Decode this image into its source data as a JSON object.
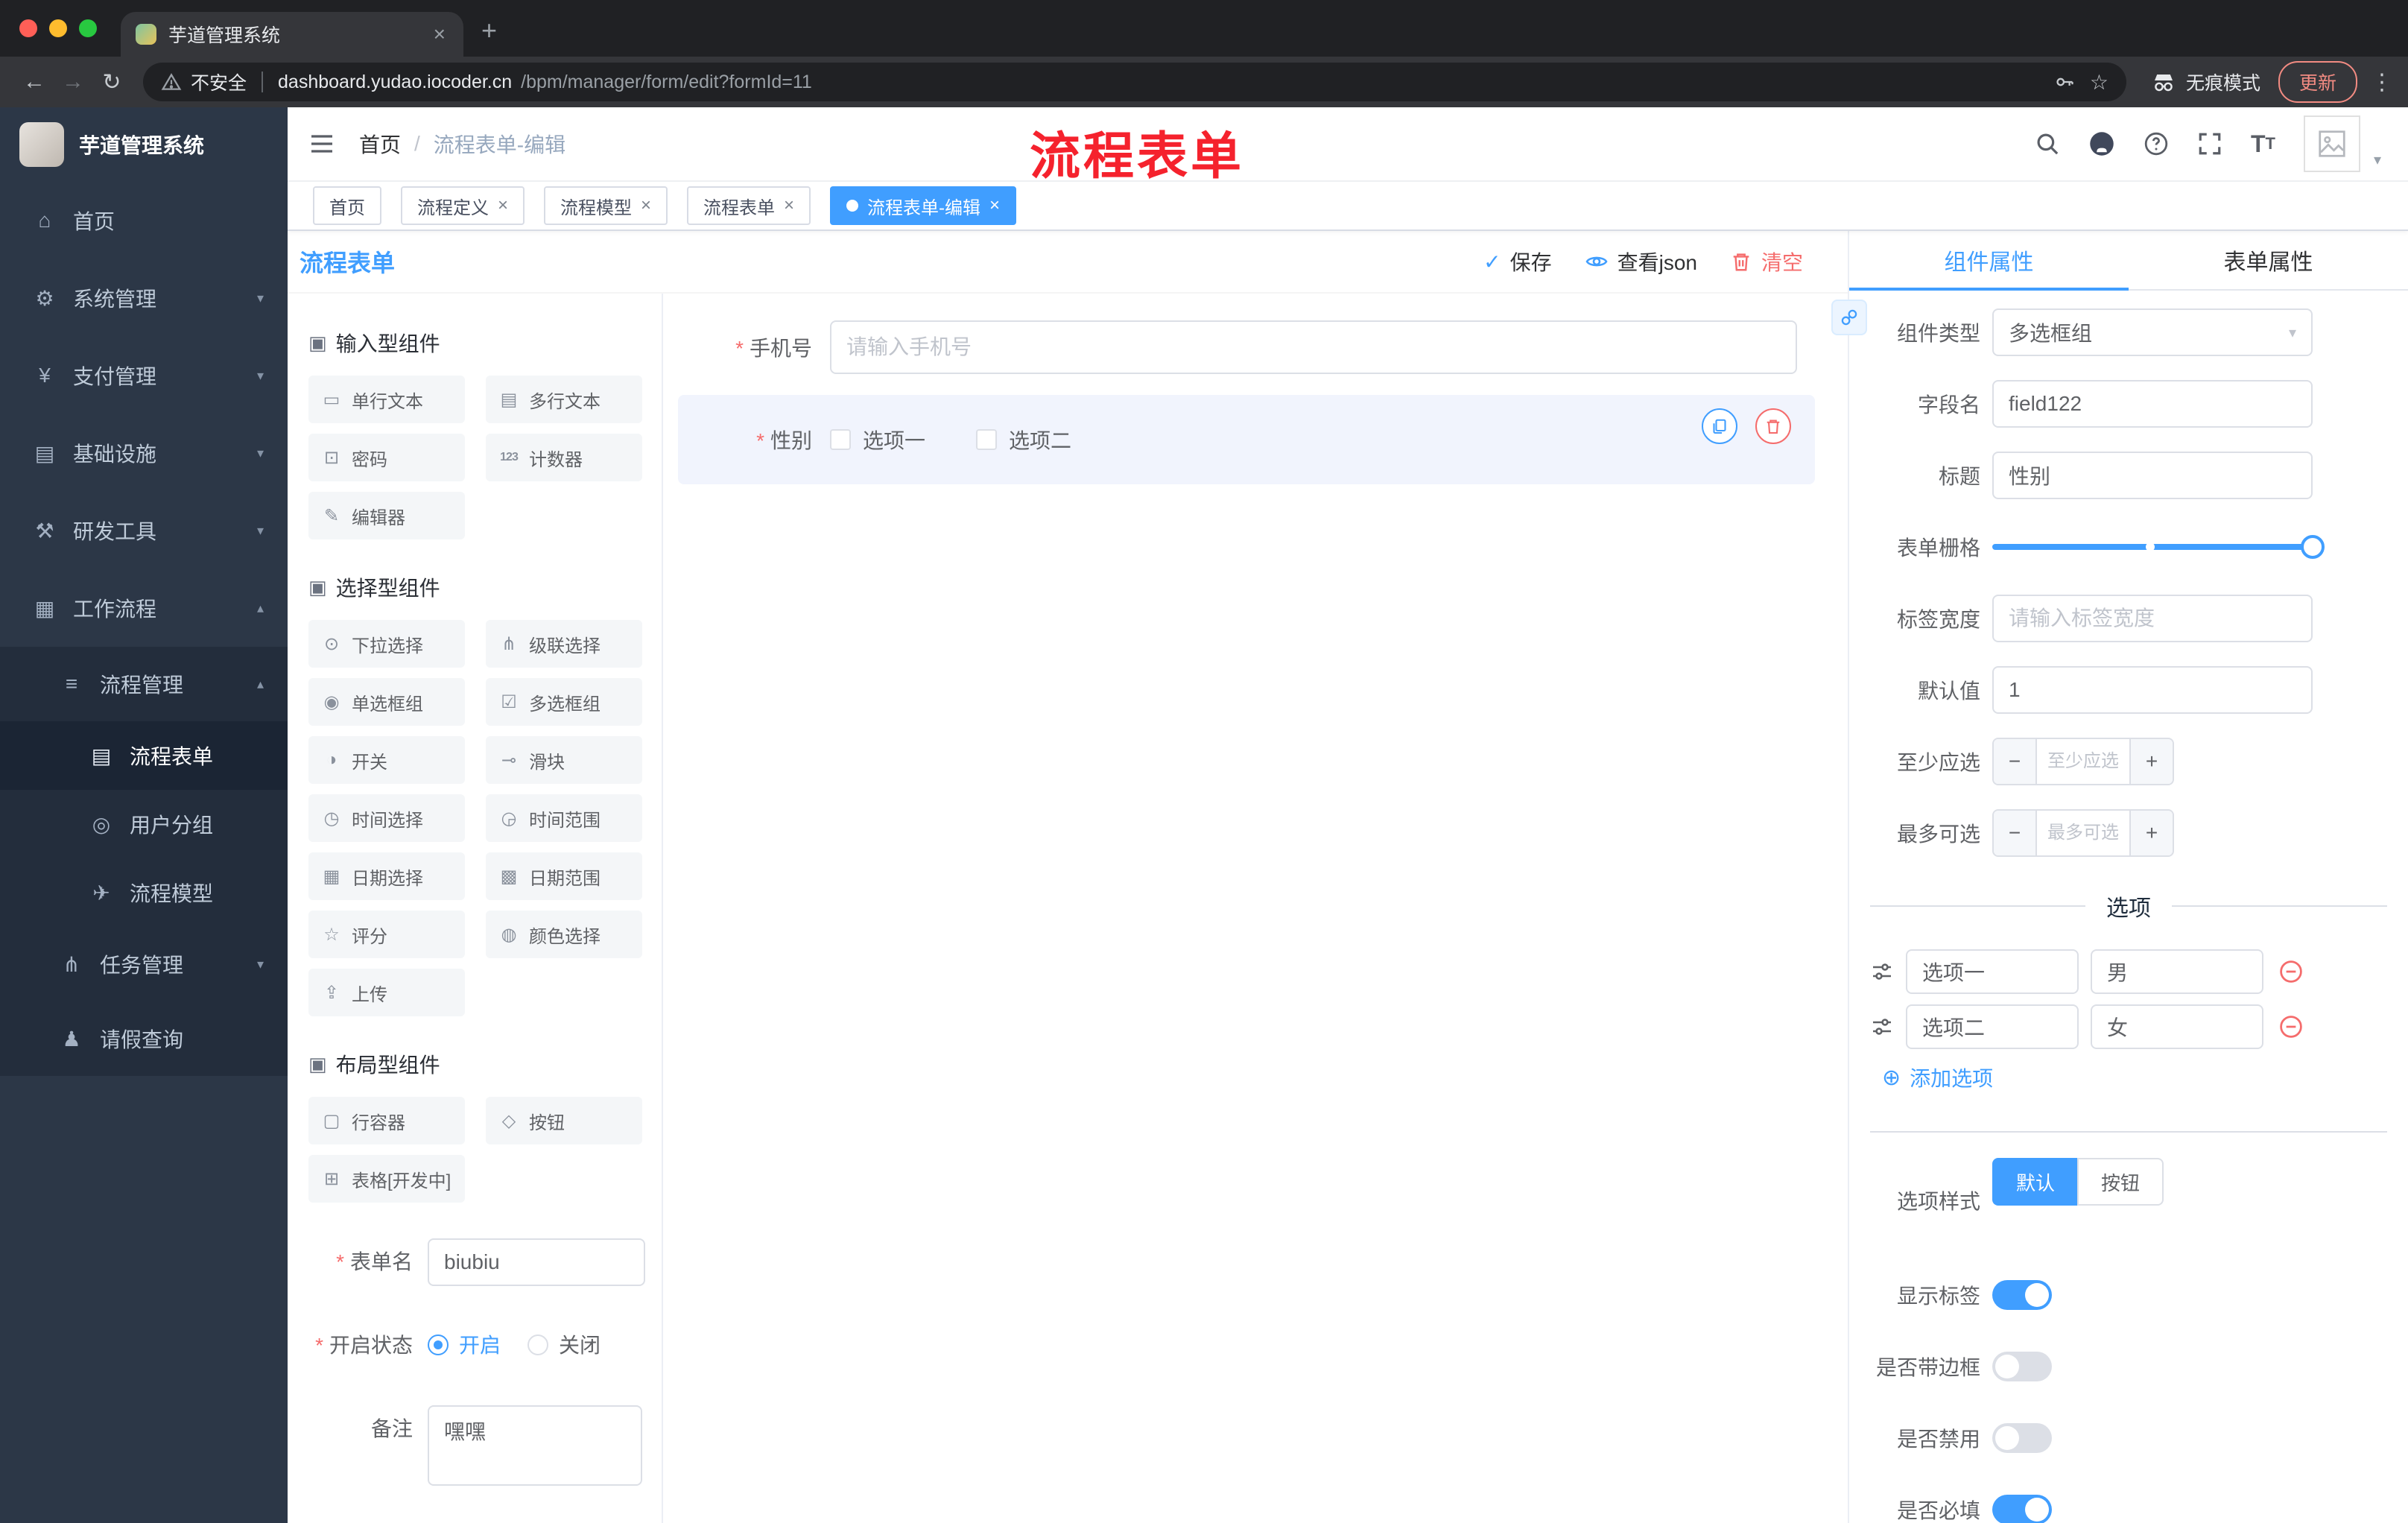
{
  "browser": {
    "tab_title": "芋道管理系统",
    "security": "不安全",
    "url_domain": "dashboard.yudao.iocoder.cn",
    "url_path": "/bpm/manager/form/edit?formId=11",
    "incognito": "无痕模式",
    "update": "更新"
  },
  "sidebar": {
    "title": "芋道管理系统",
    "items": [
      {
        "label": "首页",
        "icon": "⌂"
      },
      {
        "label": "系统管理",
        "icon": "⚙"
      },
      {
        "label": "支付管理",
        "icon": "¥"
      },
      {
        "label": "基础设施",
        "icon": "▤"
      },
      {
        "label": "研发工具",
        "icon": "⚒"
      },
      {
        "label": "工作流程",
        "icon": "▦"
      }
    ],
    "submenu": {
      "manage": {
        "label": "流程管理",
        "icon": "≡"
      },
      "children": [
        {
          "label": "流程表单",
          "icon": "▤"
        },
        {
          "label": "用户分组",
          "icon": "◎"
        },
        {
          "label": "流程模型",
          "icon": "✈"
        }
      ],
      "tasks": {
        "label": "任务管理",
        "icon": "⋔"
      },
      "leave": {
        "label": "请假查询",
        "icon": "♟"
      }
    }
  },
  "header": {
    "breadcrumb_home": "首页",
    "breadcrumb_sep": "/",
    "breadcrumb_current": "流程表单-编辑",
    "annotation": "流程表单"
  },
  "tags": [
    {
      "label": "首页"
    },
    {
      "label": "流程定义"
    },
    {
      "label": "流程模型"
    },
    {
      "label": "流程表单"
    },
    {
      "label": "流程表单-编辑"
    }
  ],
  "designer": {
    "title": "流程表单",
    "actions": {
      "save": "保存",
      "view_json": "查看json",
      "clear": "清空"
    },
    "groups": [
      {
        "title": "输入型组件",
        "items": [
          {
            "label": "单行文本",
            "icon": "▭"
          },
          {
            "label": "多行文本",
            "icon": "▤"
          },
          {
            "label": "密码",
            "icon": "⊡"
          },
          {
            "label": "计数器",
            "icon": "123"
          },
          {
            "label": "编辑器",
            "icon": "✎"
          }
        ]
      },
      {
        "title": "选择型组件",
        "items": [
          {
            "label": "下拉选择",
            "icon": "⊙"
          },
          {
            "label": "级联选择",
            "icon": "⋔"
          },
          {
            "label": "单选框组",
            "icon": "◉"
          },
          {
            "label": "多选框组",
            "icon": "☑"
          },
          {
            "label": "开关",
            "icon": "◑"
          },
          {
            "label": "滑块",
            "icon": "⊸"
          },
          {
            "label": "时间选择",
            "icon": "◷"
          },
          {
            "label": "时间范围",
            "icon": "◶"
          },
          {
            "label": "日期选择",
            "icon": "▦"
          },
          {
            "label": "日期范围",
            "icon": "▩"
          },
          {
            "label": "评分",
            "icon": "☆"
          },
          {
            "label": "颜色选择",
            "icon": "◍"
          },
          {
            "label": "上传",
            "icon": "⇪"
          }
        ]
      },
      {
        "title": "布局型组件",
        "items": [
          {
            "label": "行容器",
            "icon": "▢"
          },
          {
            "label": "按钮",
            "icon": "◇"
          },
          {
            "label": "表格[开发中]",
            "icon": "⊞"
          }
        ]
      }
    ],
    "meta": {
      "name_label": "表单名",
      "name_value": "biubiu",
      "status_label": "开启状态",
      "status_on": "开启",
      "status_off": "关闭",
      "remark_label": "备注",
      "remark_value": "嘿嘿"
    }
  },
  "canvas": {
    "phone": {
      "label": "手机号",
      "placeholder": "请输入手机号"
    },
    "gender": {
      "label": "性别",
      "options": [
        "选项一",
        "选项二"
      ]
    }
  },
  "panel": {
    "tabs": {
      "component": "组件属性",
      "form": "表单属性"
    },
    "type": {
      "label": "组件类型",
      "value": "多选框组"
    },
    "field": {
      "label": "字段名",
      "value": "field122"
    },
    "title": {
      "label": "标题",
      "value": "性别"
    },
    "grid": {
      "label": "表单栅格"
    },
    "width": {
      "label": "标签宽度",
      "placeholder": "请输入标签宽度"
    },
    "default": {
      "label": "默认值",
      "value": "1"
    },
    "min": {
      "label": "至少应选",
      "placeholder": "至少应选"
    },
    "max": {
      "label": "最多可选",
      "placeholder": "最多可选"
    },
    "options_title": "选项",
    "options": [
      {
        "label": "选项一",
        "value": "男"
      },
      {
        "label": "选项二",
        "value": "女"
      }
    ],
    "add_option": "添加选项",
    "style": {
      "label": "选项样式",
      "default": "默认",
      "button": "按钮"
    },
    "show_label": "显示标签",
    "border": "是否带边框",
    "disabled": "是否禁用",
    "required": "是否必填"
  }
}
